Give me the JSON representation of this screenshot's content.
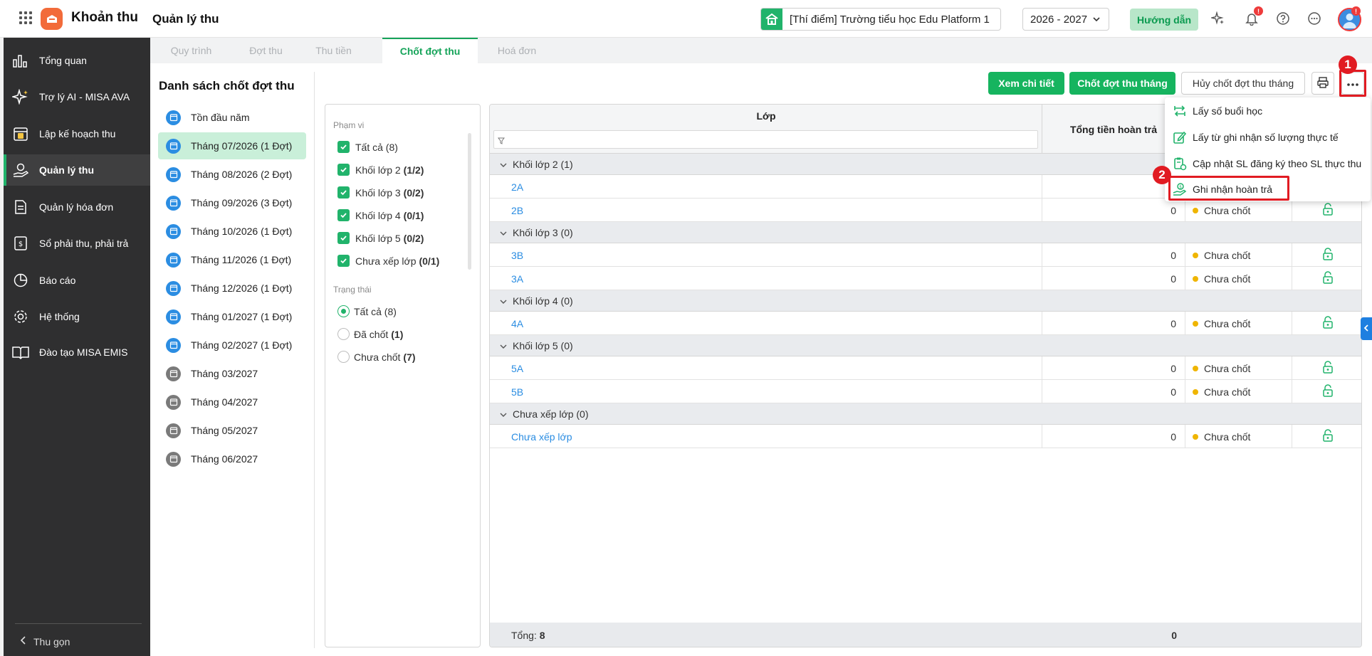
{
  "header": {
    "app_title": "Khoản thu",
    "module_title": "Quản lý thu",
    "school": "[Thí điểm] Trường tiểu học Edu Platform 1",
    "year": "2026 - 2027",
    "guide_label": "Hướng dẫn",
    "notification_badge": "!",
    "avatar_badge": "!"
  },
  "sidebar": {
    "items": [
      {
        "label": "Tổng quan",
        "icon": "chart-bars-icon"
      },
      {
        "label": "Trợ lý AI - MISA AVA",
        "icon": "sparkle-icon"
      },
      {
        "label": "Lập kế hoạch thu",
        "icon": "calendar-money-icon"
      },
      {
        "label": "Quản lý thu",
        "icon": "hand-coin-icon"
      },
      {
        "label": "Quản lý hóa đơn",
        "icon": "invoice-icon"
      },
      {
        "label": "Sổ phải thu, phải trả",
        "icon": "ledger-icon"
      },
      {
        "label": "Báo cáo",
        "icon": "pie-chart-icon"
      },
      {
        "label": "Hệ thống",
        "icon": "gear-icon"
      },
      {
        "label": "Đào tạo MISA EMIS",
        "icon": "book-icon"
      }
    ],
    "collapse_label": "Thu gọn"
  },
  "tabs": [
    "Quy trình",
    "Đợt thu",
    "Thu tiền",
    "Chốt đợt thu",
    "Hoá đơn"
  ],
  "list": {
    "title": "Danh sách chốt đợt thu",
    "items": [
      "Tồn đầu năm",
      "Tháng 07/2026 (1 Đợt)",
      "Tháng 08/2026 (2 Đợt)",
      "Tháng 09/2026 (3 Đợt)",
      "Tháng 10/2026 (1 Đợt)",
      "Tháng 11/2026 (1 Đợt)",
      "Tháng 12/2026 (1 Đợt)",
      "Tháng 01/2027 (1 Đợt)",
      "Tháng 02/2027 (1 Đợt)",
      "Tháng 03/2027",
      "Tháng 04/2027",
      "Tháng 05/2027",
      "Tháng 06/2027"
    ]
  },
  "filter": {
    "scope_title": "Phạm vi",
    "scope": [
      {
        "label": "Tất cả",
        "count": "(8)"
      },
      {
        "label": "Khối lớp 2",
        "count": "(1/2)"
      },
      {
        "label": "Khối lớp 3",
        "count": "(0/2)"
      },
      {
        "label": "Khối lớp 4",
        "count": "(0/1)"
      },
      {
        "label": "Khối lớp 5",
        "count": "(0/2)"
      },
      {
        "label": "Chưa xếp lớp",
        "count": "(0/1)"
      }
    ],
    "status_title": "Trạng thái",
    "status": [
      {
        "label": "Tất cả",
        "count": "(8)"
      },
      {
        "label": "Đã chốt",
        "count": "(1)"
      },
      {
        "label": "Chưa chốt",
        "count": "(7)"
      }
    ]
  },
  "toolbar": {
    "view_detail": "Xem chi tiết",
    "close_month": "Chốt đợt thu tháng",
    "cancel_close": "Hủy chốt đợt thu tháng"
  },
  "grid": {
    "col_class": "Lớp",
    "col_total": "Tổng tiền hoàn trả",
    "groups": [
      {
        "label": "Khối lớp 2 (1)",
        "rows": [
          {
            "name": "2A",
            "total": "",
            "status": ""
          },
          {
            "name": "2B",
            "total": "0",
            "status": "Chưa chốt"
          }
        ]
      },
      {
        "label": "Khối lớp 3 (0)",
        "rows": [
          {
            "name": "3B",
            "total": "0",
            "status": "Chưa chốt"
          },
          {
            "name": "3A",
            "total": "0",
            "status": "Chưa chốt"
          }
        ]
      },
      {
        "label": "Khối lớp 4 (0)",
        "rows": [
          {
            "name": "4A",
            "total": "0",
            "status": "Chưa chốt"
          }
        ]
      },
      {
        "label": "Khối lớp 5 (0)",
        "rows": [
          {
            "name": "5A",
            "total": "0",
            "status": "Chưa chốt"
          },
          {
            "name": "5B",
            "total": "0",
            "status": "Chưa chốt"
          }
        ]
      },
      {
        "label": "Chưa xếp lớp (0)",
        "rows": [
          {
            "name": "Chưa xếp lớp",
            "total": "0",
            "status": "Chưa chốt"
          }
        ]
      }
    ],
    "footer_label": "Tổng:",
    "footer_count": "8",
    "footer_sum": "0"
  },
  "menu": {
    "items": [
      "Lấy số buổi học",
      "Lấy từ ghi nhận số lượng thực tế",
      "Cập nhật SL đăng ký theo SL thực thu",
      "Ghi nhận hoàn trả"
    ]
  },
  "annotations": {
    "step1": "1",
    "step2": "2"
  },
  "colors": {
    "brand_green": "#16b45f",
    "accent_red": "#e11b22",
    "sidebar_bg": "#2f2f30",
    "link_blue": "#2b8de2",
    "status_dot": "#efb500"
  }
}
